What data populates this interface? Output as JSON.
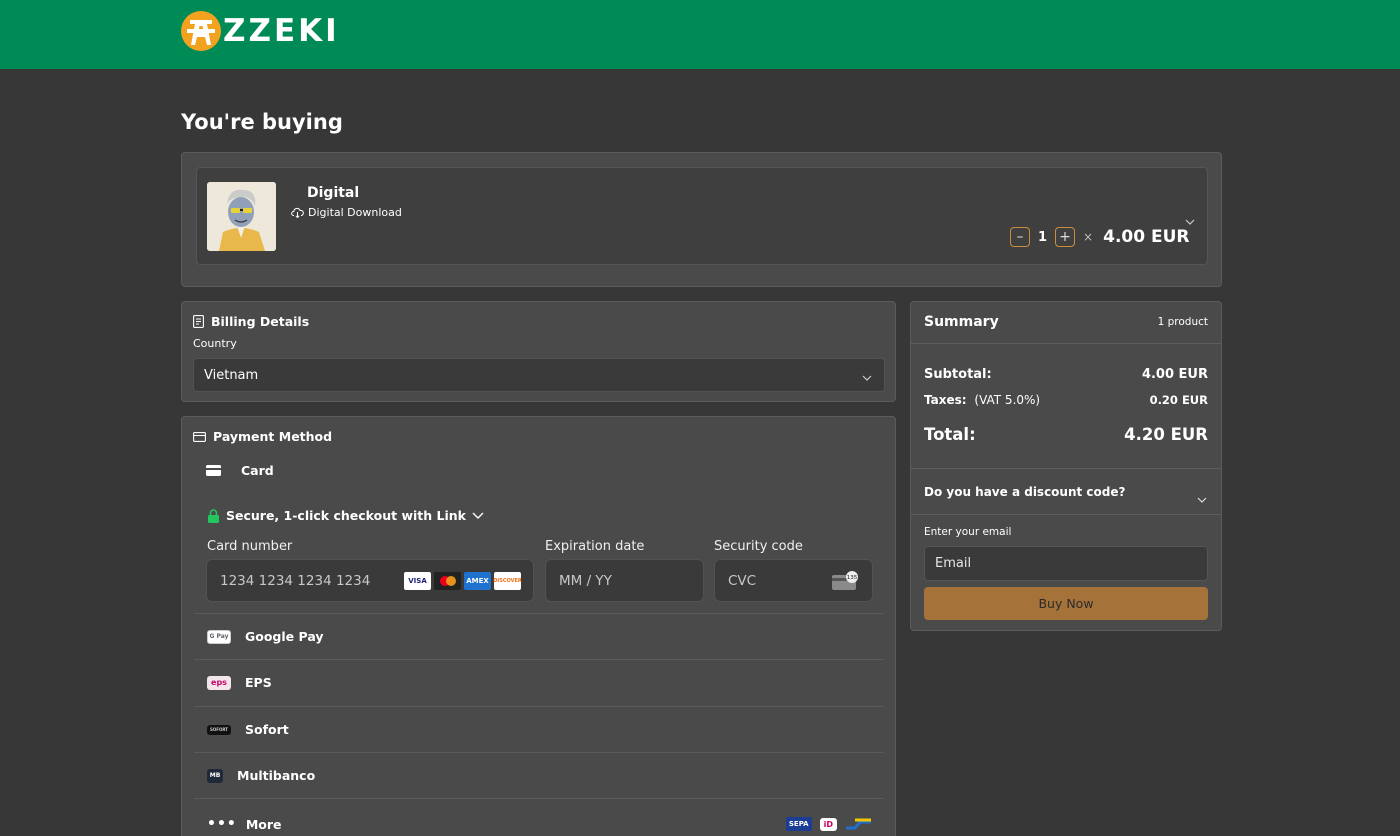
{
  "brand": {
    "name": "ZZEKI",
    "logo_glyph": "A",
    "accent": "#008a55",
    "logo_color": "#f2a21e"
  },
  "page": {
    "title": "You're buying"
  },
  "product": {
    "name": "Digital",
    "delivery": "Digital Download",
    "quantity": "1",
    "times": "×",
    "price": "4.00 EUR"
  },
  "billing": {
    "heading": "Billing Details",
    "country_label": "Country",
    "country_value": "Vietnam"
  },
  "payment": {
    "heading": "Payment Method",
    "card_label": "Card",
    "link_label": "Secure, 1-click checkout with Link",
    "card_number_label": "Card number",
    "card_number_placeholder": "1234 1234 1234 1234",
    "expiry_label": "Expiration date",
    "expiry_placeholder": "MM / YY",
    "cvc_label": "Security code",
    "cvc_placeholder": "CVC",
    "cvc_icon_text": "135",
    "card_brands": [
      "VISA",
      "mastercard",
      "AMEX",
      "DISCOVER"
    ],
    "methods": [
      {
        "label": "Google Pay",
        "icon_text": "G Pay"
      },
      {
        "label": "EPS",
        "icon_text": "eps"
      },
      {
        "label": "Sofort",
        "icon_text": "SOFORT"
      },
      {
        "label": "Multibanco",
        "icon_text": "MB"
      }
    ],
    "more_label": "More",
    "more_icons": [
      "SEPA",
      "iD",
      "bancontact"
    ]
  },
  "summary": {
    "title": "Summary",
    "count": "1 product",
    "subtotal_label": "Subtotal:",
    "subtotal_value": "4.00 EUR",
    "taxes_label": "Taxes:",
    "taxes_detail": "(VAT 5.0%)",
    "taxes_value": "0.20 EUR",
    "total_label": "Total:",
    "total_value": "4.20 EUR",
    "discount_question": "Do you have a discount code?",
    "email_label": "Enter your email",
    "email_placeholder": "Email",
    "buy_label": "Buy Now",
    "buy_color": "#a5733a"
  }
}
